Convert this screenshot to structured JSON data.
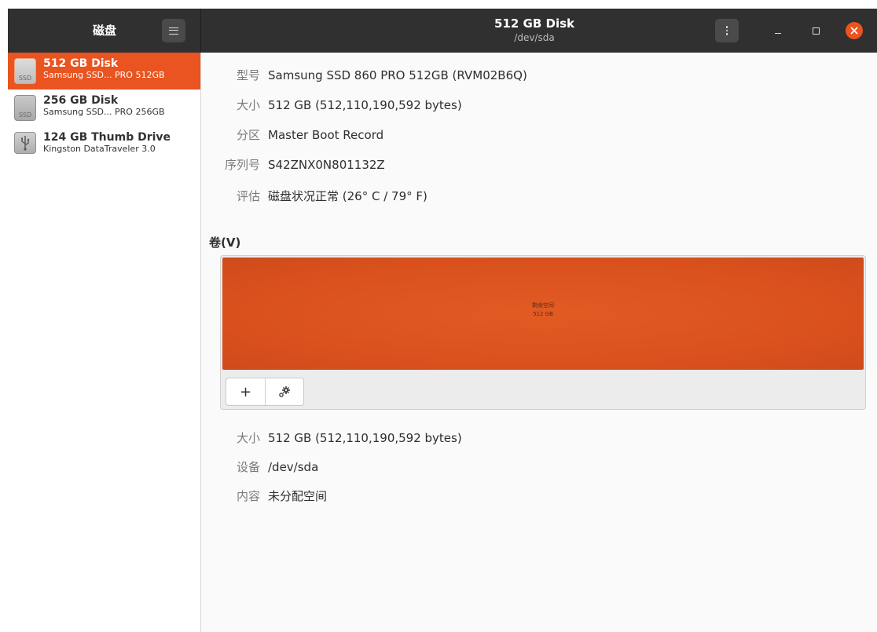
{
  "sidebar": {
    "title": "磁盘",
    "disks": [
      {
        "name": "512 GB Disk",
        "model": "Samsung SSD... PRO 512GB",
        "icon_label": "SSD",
        "icon": "ssd-drive-icon"
      },
      {
        "name": "256 GB Disk",
        "model": "Samsung SSD... PRO 256GB",
        "icon_label": "SSD",
        "icon": "ssd-drive-icon"
      },
      {
        "name": "124 GB Thumb Drive",
        "model": "Kingston DataTraveler 3.0",
        "icon": "usb-drive-icon"
      }
    ]
  },
  "header": {
    "title": "512 GB Disk",
    "subtitle": "/dev/sda"
  },
  "drive_info": [
    {
      "label": "型号",
      "value": "Samsung SSD 860 PRO 512GB (RVM02B6Q)"
    },
    {
      "label": "大小",
      "value": "512 GB (512,110,190,592 bytes)"
    },
    {
      "label": "分区",
      "value": "Master Boot Record"
    },
    {
      "label": "序列号",
      "value": "S42ZNX0N801132Z"
    },
    {
      "label": "评估",
      "value": "磁盘状况正常 (26° C / 79° F)"
    }
  ],
  "volumes": {
    "heading": "卷(V)",
    "block_label": "剩余空间",
    "block_size": "512 GB",
    "add_symbol": "+"
  },
  "volume_info": [
    {
      "label": "大小",
      "value": "512 GB (512,110,190,592 bytes)"
    },
    {
      "label": "设备",
      "value": "/dev/sda"
    },
    {
      "label": "内容",
      "value": "未分配空间"
    }
  ],
  "colors": {
    "accent": "#e95420",
    "header_bg": "#303030",
    "volume_fill": "#d9501d"
  }
}
